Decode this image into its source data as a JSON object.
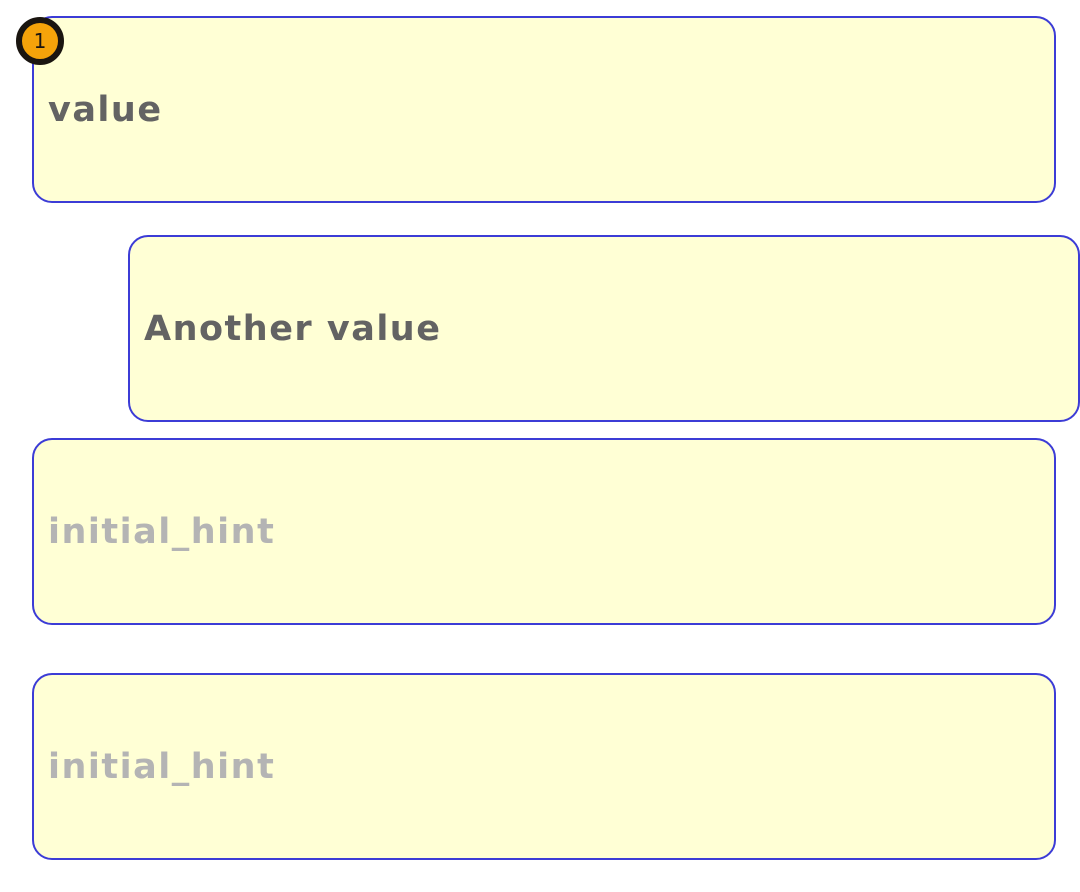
{
  "fields": [
    {
      "value": "value",
      "placeholder": ""
    },
    {
      "value": "Another value",
      "placeholder": ""
    },
    {
      "value": "",
      "placeholder": "initial_hint"
    },
    {
      "value": "",
      "placeholder": "initial_hint"
    }
  ],
  "badge": {
    "label": "1"
  },
  "colors": {
    "field_background": "#ffffd5",
    "field_border": "#3c3cd6",
    "value_text": "#636363",
    "hint_text": "#b4b4b4",
    "badge_fill": "#f5a30a",
    "badge_outline": "#1a1510"
  }
}
